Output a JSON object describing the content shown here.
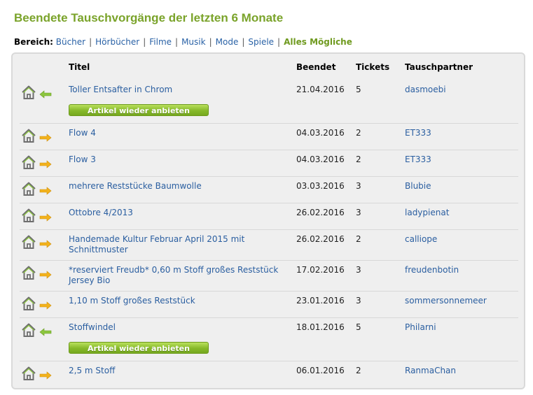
{
  "page_title": "Beendete Tauschvorgänge der letzten 6 Monate",
  "filter": {
    "label": "Bereich:",
    "items": [
      "Bücher",
      "Hörbücher",
      "Filme",
      "Musik",
      "Mode",
      "Spiele",
      "Alles Mögliche"
    ],
    "active_index": 6
  },
  "table": {
    "headers": {
      "title": "Titel",
      "ended": "Beendet",
      "tickets": "Tickets",
      "partner": "Tauschpartner"
    },
    "rows": [
      {
        "title": "Toller Entsafter in Chrom",
        "ended": "21.04.2016",
        "tickets": "5",
        "partner": "dasmoebi",
        "direction": "in",
        "reoffer": true
      },
      {
        "title": "Flow 4",
        "ended": "04.03.2016",
        "tickets": "2",
        "partner": "ET333",
        "direction": "out",
        "reoffer": false
      },
      {
        "title": "Flow 3",
        "ended": "04.03.2016",
        "tickets": "2",
        "partner": "ET333",
        "direction": "out",
        "reoffer": false
      },
      {
        "title": "mehrere Reststücke Baumwolle",
        "ended": "03.03.2016",
        "tickets": "3",
        "partner": "Blubie",
        "direction": "out",
        "reoffer": false
      },
      {
        "title": "Ottobre 4/2013",
        "ended": "26.02.2016",
        "tickets": "3",
        "partner": "ladypienat",
        "direction": "out",
        "reoffer": false
      },
      {
        "title": "Handemade Kultur Februar April 2015 mit Schnittmuster",
        "ended": "26.02.2016",
        "tickets": "2",
        "partner": "calliope",
        "direction": "out",
        "reoffer": false
      },
      {
        "title": "*reserviert Freudb* 0,60 m Stoff großes Reststück Jersey Bio",
        "ended": "17.02.2016",
        "tickets": "3",
        "partner": "freudenbotin",
        "direction": "out",
        "reoffer": false
      },
      {
        "title": "1,10 m Stoff großes Reststück",
        "ended": "23.01.2016",
        "tickets": "3",
        "partner": "sommersonnemeer",
        "direction": "out",
        "reoffer": false
      },
      {
        "title": "Stoffwindel",
        "ended": "18.01.2016",
        "tickets": "5",
        "partner": "Philarni",
        "direction": "in",
        "reoffer": true
      },
      {
        "title": "2,5 m Stoff",
        "ended": "06.01.2016",
        "tickets": "2",
        "partner": "RanmaChan",
        "direction": "out",
        "reoffer": false
      }
    ],
    "reoffer_label": "Artikel wieder anbieten"
  },
  "icons": {
    "home": "home-icon",
    "arrow_in": "arrow-left-icon",
    "arrow_out": "arrow-right-icon"
  },
  "colors": {
    "title_green": "#7aa32a",
    "link_blue": "#2a5ea0",
    "arrow_in_green": "#8cc63f",
    "arrow_out_orange": "#f2b21c",
    "button_green": "#86b92a"
  }
}
